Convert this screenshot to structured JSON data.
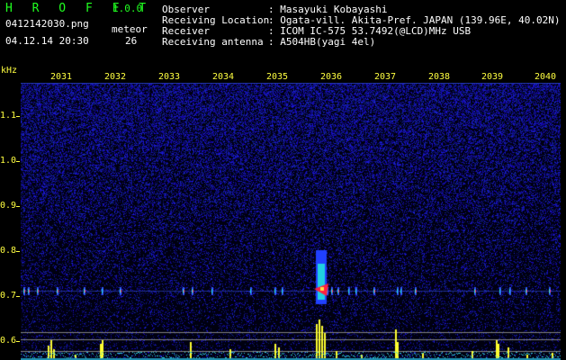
{
  "header": {
    "app_name": "H R O F F T",
    "version": "1.0.0",
    "filename": "0412142030.png",
    "meteor_label": "meteor",
    "datetime": "04.12.14 20:30",
    "meteor_count": "26",
    "info": [
      {
        "label": "Observer",
        "value": ": Masayuki Kobayashi"
      },
      {
        "label": "Receiving Location",
        "value": ": Ogata-vill. Akita-Pref. JAPAN (139.96E, 40.02N)"
      },
      {
        "label": "Receiver",
        "value": ": ICOM IC-575 53.7492(@LCD)MHz USB"
      },
      {
        "label": "Receiving antenna",
        "value": ": A504HB(yagi 4el)"
      }
    ]
  },
  "y_axis": {
    "unit": "kHz",
    "labels": [
      "1.1",
      "1.0",
      "0.9",
      "0.8",
      "0.7",
      "0.6"
    ]
  },
  "x_axis": {
    "labels": [
      "2031",
      "2032",
      "2033",
      "2034",
      "2035",
      "2036",
      "2037",
      "2038",
      "2039",
      "2040"
    ]
  },
  "colors": {
    "background": "#000000",
    "noise": "#1020c0",
    "text": "#ffffff",
    "accent_green": "#20ff20",
    "axis_yellow": "#ffff40",
    "meteor_red": "#ff2040",
    "meteor_cyan": "#20e0e0"
  }
}
